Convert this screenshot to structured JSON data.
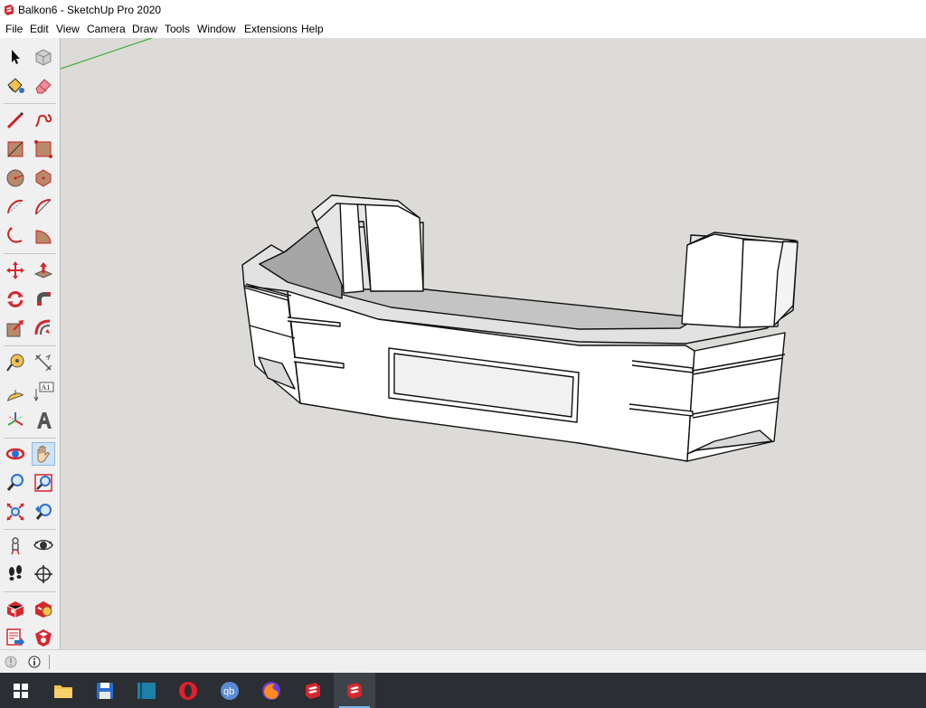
{
  "window": {
    "title": "Balkon6 - SketchUp Pro 2020",
    "app_icon": "sketchup-logo-icon"
  },
  "menubar": {
    "items": [
      "File",
      "Edit",
      "View",
      "Camera",
      "Draw",
      "Tools",
      "Window",
      "Extensions",
      "Help"
    ]
  },
  "toolbar": {
    "tools": [
      "select-arrow-icon",
      "component-icon",
      "paint-bucket-icon",
      "eraser-icon",
      "pencil-line-icon",
      "freehand-icon",
      "rectangle-icon",
      "rotated-rectangle-icon",
      "circle-icon",
      "polygon-icon",
      "arc-icon",
      "two-point-arc-icon",
      "three-point-arc-icon",
      "pie-icon",
      "move-icon",
      "push-pull-icon",
      "rotate-icon",
      "follow-me-icon",
      "scale-icon",
      "offset-icon",
      "tape-measure-icon",
      "dimension-icon",
      "protractor-icon",
      "text-icon",
      "axes-icon",
      "3d-text-icon",
      "orbit-icon",
      "pan-hand-icon",
      "zoom-icon",
      "zoom-window-icon",
      "zoom-extents-icon",
      "previous-view-icon",
      "position-camera-icon",
      "look-around-icon",
      "walk-icon",
      "section-plane-icon",
      "3d-warehouse-icon",
      "extension-warehouse-icon",
      "layout-send-icon",
      "extension-manager-icon"
    ],
    "active_tool": "pan-hand-icon"
  },
  "statusbar": {
    "icons": [
      "geo-location-icon",
      "info-icon"
    ]
  },
  "taskbar": {
    "items": [
      "windows-start-icon",
      "file-explorer-icon",
      "save-floppy-icon",
      "book-app-icon",
      "opera-icon",
      "qbittorrent-icon",
      "firefox-icon",
      "sketchup-icon",
      "sketchup-active-icon"
    ],
    "qb_label": "qb",
    "active_item": "sketchup-active-icon"
  },
  "text_tool_label": "A1",
  "colors": {
    "viewport_bg": "#dcdbd8",
    "taskbar_bg": "#2b2e33",
    "toolbar_bg": "#f0f0f0",
    "axis_green": "#3fae3f",
    "sketchup_red": "#d7262c"
  }
}
